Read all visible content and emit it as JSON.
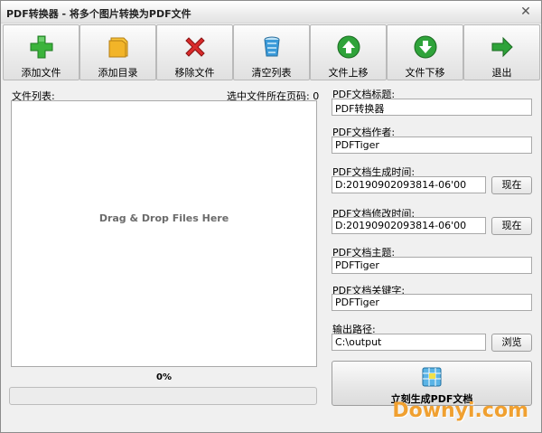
{
  "window": {
    "title": "PDF转换器 - 将多个图片转换为PDF文件",
    "close_glyph": "✕"
  },
  "toolbar": {
    "buttons": [
      {
        "label": "添加文件",
        "icon": "plus-icon",
        "color": "#3bb33b"
      },
      {
        "label": "添加目录",
        "icon": "folder-icon",
        "color": "#f2b428"
      },
      {
        "label": "移除文件",
        "icon": "x-icon",
        "color": "#d92b2b"
      },
      {
        "label": "清空列表",
        "icon": "trash-bin-icon",
        "color": "#3a9ad9"
      },
      {
        "label": "文件上移",
        "icon": "arrow-up-icon",
        "color": "#2fa33a"
      },
      {
        "label": "文件下移",
        "icon": "arrow-down-icon",
        "color": "#2fa33a"
      },
      {
        "label": "退出",
        "icon": "arrow-right-icon",
        "color": "#2fa33a"
      }
    ]
  },
  "file_list": {
    "label": "文件列表:",
    "page_count_label": "选中文件所在页码: 0",
    "drop_message": "Drag & Drop Files Here"
  },
  "progress": {
    "percent_text": "0%",
    "value": 0
  },
  "form": {
    "title_label": "PDF文档标题:",
    "title_value": "PDF转换器",
    "author_label": "PDF文档作者:",
    "author_value": "PDFTiger",
    "created_label": "PDF文档生成时间:",
    "created_value": "D:20190902093814-06'00",
    "created_now": "现在",
    "modified_label": "PDF文档修改时间:",
    "modified_value": "D:20190902093814-06'00",
    "modified_now": "现在",
    "subject_label": "PDF文档主题:",
    "subject_value": "PDFTiger",
    "keywords_label": "PDF文档关键字:",
    "keywords_value": "PDFTiger",
    "output_label": "输出路径:",
    "output_value": "C:\\output",
    "browse": "浏览"
  },
  "generate": {
    "label": "立刻生成PDF文档",
    "icon": "document-grid-icon"
  },
  "watermark": "Downyi.com"
}
